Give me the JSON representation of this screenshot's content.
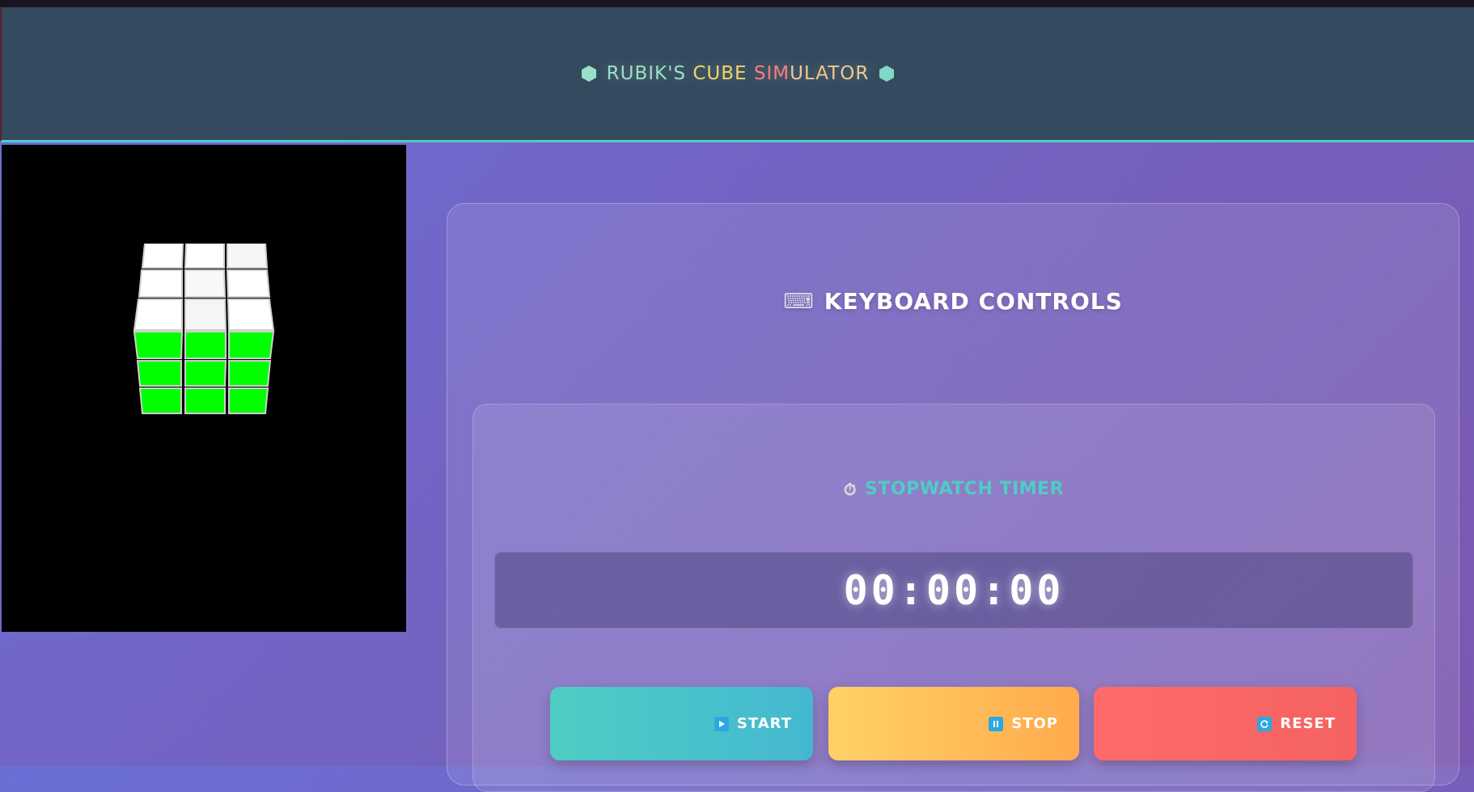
{
  "header": {
    "title_part1": "RUBIK'S",
    "title_part2": "CUBE",
    "title_part3": "SIM",
    "title_part4": "ULATOR",
    "icon_left": "hexagon-icon",
    "icon_right": "hexagon-icon"
  },
  "controls": {
    "title": "KEYBOARD CONTROLS",
    "icon": "keyboard-icon"
  },
  "stopwatch": {
    "title": "STOPWATCH TIMER",
    "icon": "stopwatch-icon",
    "time": "00:00:00",
    "buttons": {
      "start": "START",
      "stop": "STOP",
      "reset": "RESET"
    }
  },
  "colors": {
    "accent": "#4ecdc4",
    "cube_front": "#00ff00",
    "cube_top": "#ffffff",
    "start": "#4ecdc4",
    "stop": "#ffb347",
    "reset": "#ff6b6b"
  }
}
